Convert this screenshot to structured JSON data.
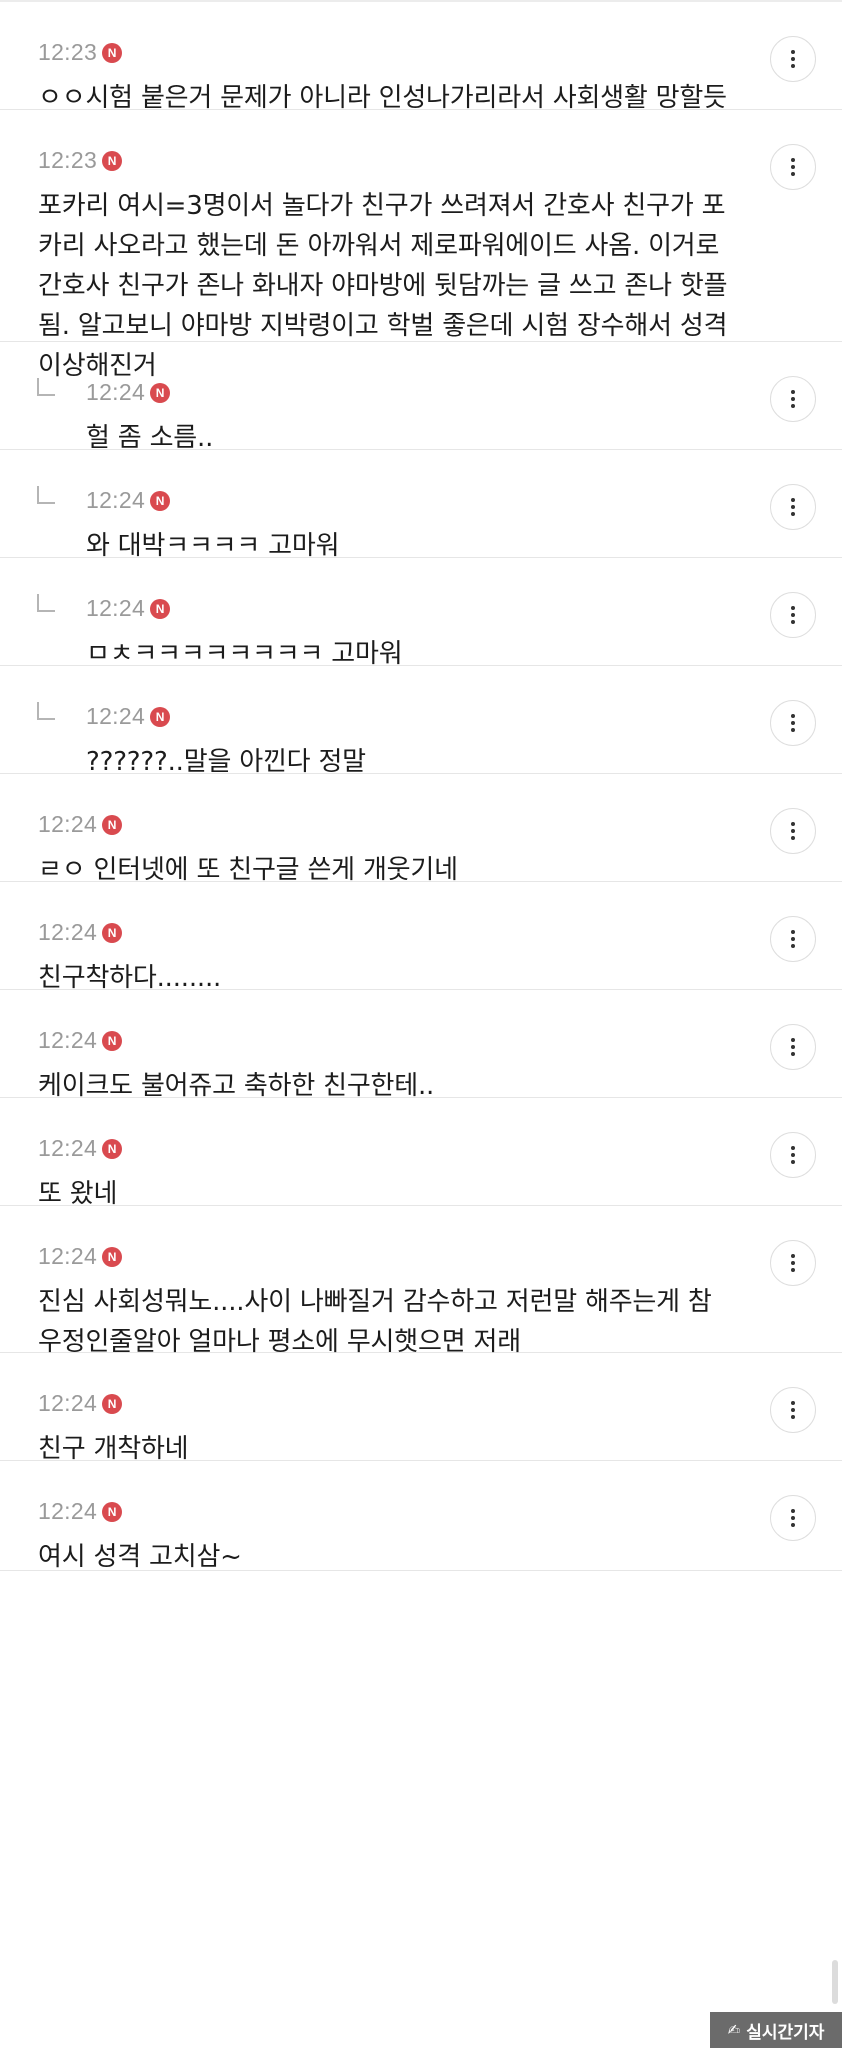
{
  "watermark": {
    "logo": "✍",
    "text": "실시간기자"
  },
  "comments": [
    {
      "time": "12:23",
      "badge": "N",
      "is_reply": false,
      "text": "ㅇㅇ시험 붙은거 문제가 아니라 인성나가리라서 사회생활 망할듯"
    },
    {
      "time": "12:23",
      "badge": "N",
      "is_reply": false,
      "text": "포카리 여시=3명이서 놀다가 친구가 쓰려져서 간호사 친구가 포카리 사오라고 했는데 돈 아까워서 제로파워에이드 사옴. 이거로 간호사 친구가 존나 화내자 야마방에 뒷담까는 글 쓰고 존나 핫플됨. 알고보니 야마방 지박령이고 학벌 좋은데 시험 장수해서 성격 이상해진거"
    },
    {
      "time": "12:24",
      "badge": "N",
      "is_reply": true,
      "text": "헐 좀 소름.."
    },
    {
      "time": "12:24",
      "badge": "N",
      "is_reply": true,
      "text": "와 대박ㅋㅋㅋㅋ 고마워"
    },
    {
      "time": "12:24",
      "badge": "N",
      "is_reply": true,
      "text": "ㅁㅊㅋㅋㅋㅋㅋㅋㅋㅋ 고마워"
    },
    {
      "time": "12:24",
      "badge": "N",
      "is_reply": true,
      "text": "??????..말을 아낀다 정말"
    },
    {
      "time": "12:24",
      "badge": "N",
      "is_reply": false,
      "text": "ㄹㅇ 인터넷에 또 친구글 쓴게 개웃기네"
    },
    {
      "time": "12:24",
      "badge": "N",
      "is_reply": false,
      "text": "친구착하다........"
    },
    {
      "time": "12:24",
      "badge": "N",
      "is_reply": false,
      "text": "케이크도 불어쥬고 축하한 친구한테.."
    },
    {
      "time": "12:24",
      "badge": "N",
      "is_reply": false,
      "text": "또 왔네"
    },
    {
      "time": "12:24",
      "badge": "N",
      "is_reply": false,
      "text": "진심 사회성뭐노....사이 나빠질거 감수하고 저런말 해주는게 참우정인줄알아 얼마나 평소에 무시햇으면 저래"
    },
    {
      "time": "12:24",
      "badge": "N",
      "is_reply": false,
      "text": "친구 개착하네"
    },
    {
      "time": "12:24",
      "badge": "N",
      "is_reply": false,
      "text": "여시 성격 고치삼~"
    }
  ]
}
